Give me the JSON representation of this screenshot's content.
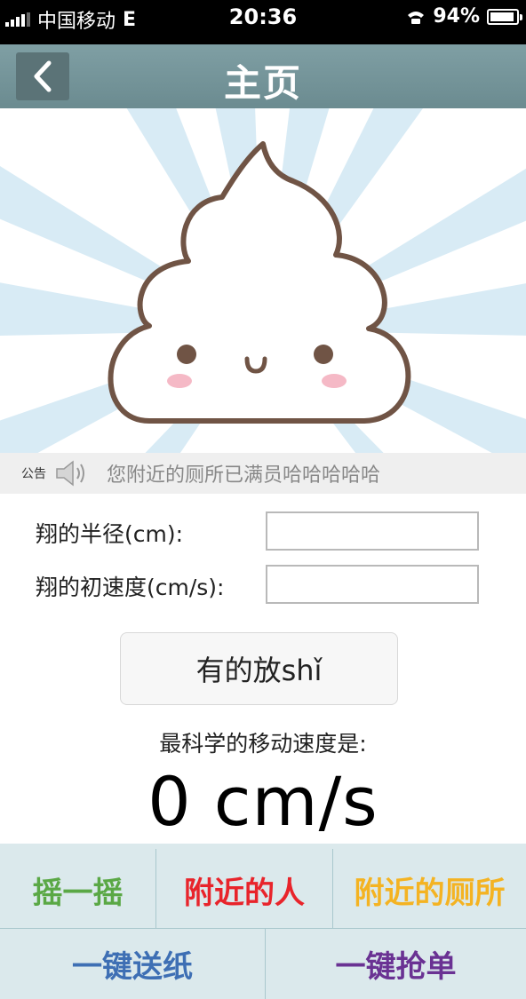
{
  "status_bar": {
    "carrier": "中国移动",
    "network": "E",
    "time": "20:36",
    "battery": "94%",
    "battery_level": 0.94
  },
  "nav": {
    "title": "主页",
    "back_icon": "chevron-left-icon"
  },
  "notice": {
    "tag": "公告",
    "icon": "speaker-icon",
    "text": "您附近的厕所已满员哈哈哈哈哈"
  },
  "form": {
    "radius_label": "翔的半径(cm):",
    "radius_value": "",
    "speed_label": "翔的初速度(cm/s):",
    "speed_value": "",
    "submit_label": "有的放shǐ",
    "result_label": "最科学的移动速度是:",
    "result_value": "0 cm/s"
  },
  "menu": {
    "items": [
      {
        "label": "摇一摇",
        "color": "#5aa845"
      },
      {
        "label": "附近的人",
        "color": "#e8242b"
      },
      {
        "label": "附近的厕所",
        "color": "#f4b322"
      },
      {
        "label": "一键送纸",
        "color": "#3e6fb4"
      },
      {
        "label": "一键抢单",
        "color": "#6a3293"
      }
    ]
  }
}
